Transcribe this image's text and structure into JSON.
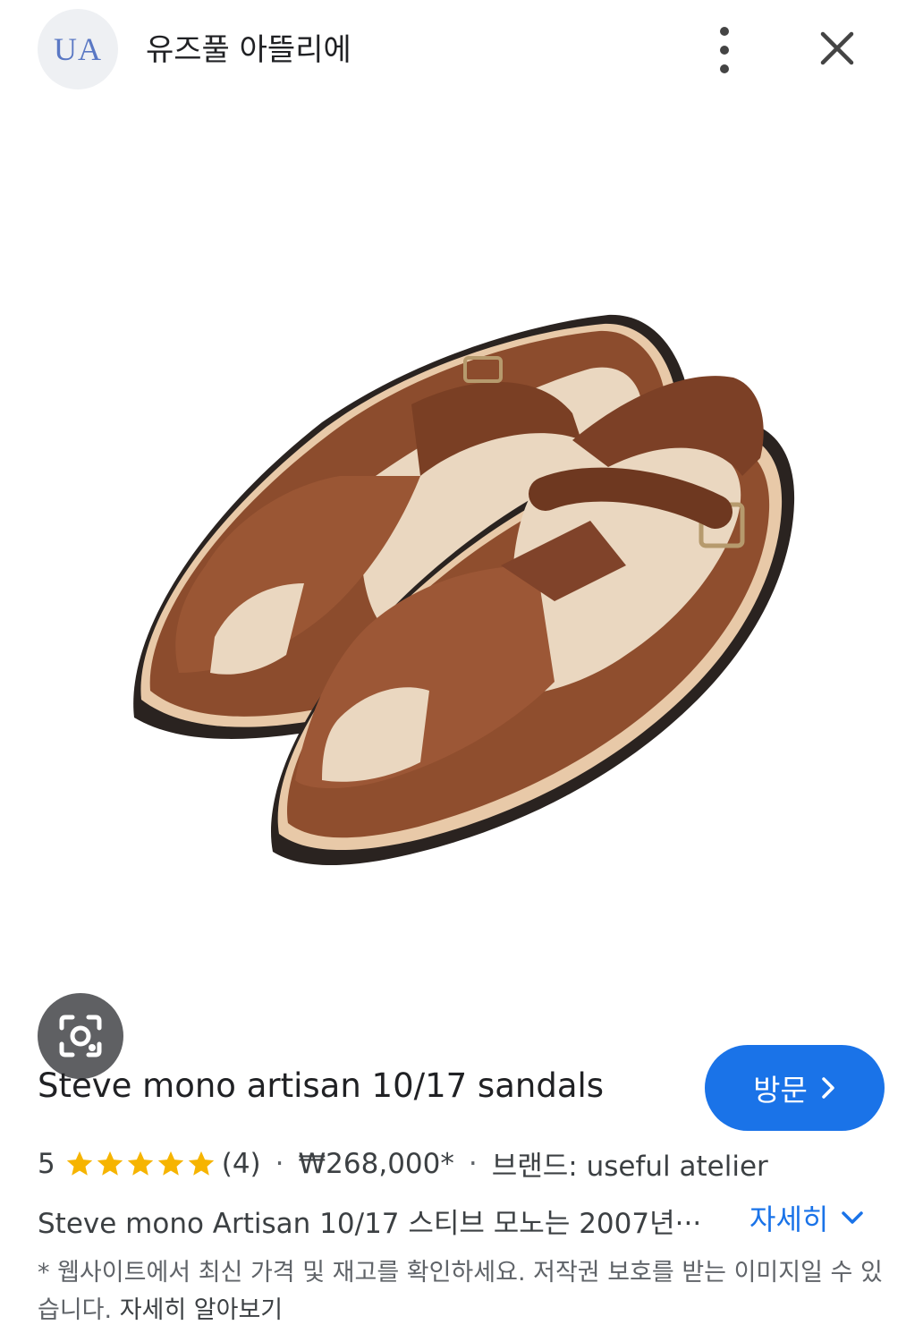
{
  "header": {
    "logo_text": "UA",
    "site_name": "유즈풀 아뜰리에",
    "icons": {
      "more": "more-vert-icon",
      "close": "close-icon"
    }
  },
  "image": {
    "alt": "Steve mono artisan 10/17 sandals",
    "lens_icon": "lens-icon"
  },
  "product": {
    "title": "Steve mono artisan 10/17 sandals",
    "visit_label": "방문",
    "rating": "5",
    "rating_stars": 5,
    "review_count": "(4)",
    "separator": "·",
    "price": "₩268,000*",
    "brand": "브랜드: useful atelier",
    "description": "Steve mono Artisan 10/17 스티브 모노는 2007년···",
    "more_label": "자세히"
  },
  "notice": {
    "text": "* 웹사이트에서 최신 가격 및 재고를 확인하세요. 저작권 보호를 받는 이미지일 수 있습니다. ",
    "learn_more": "자세히 알아보기"
  },
  "colors": {
    "accent": "#1a73e8",
    "star": "#f6b400",
    "leather": "#8a4a2c"
  }
}
